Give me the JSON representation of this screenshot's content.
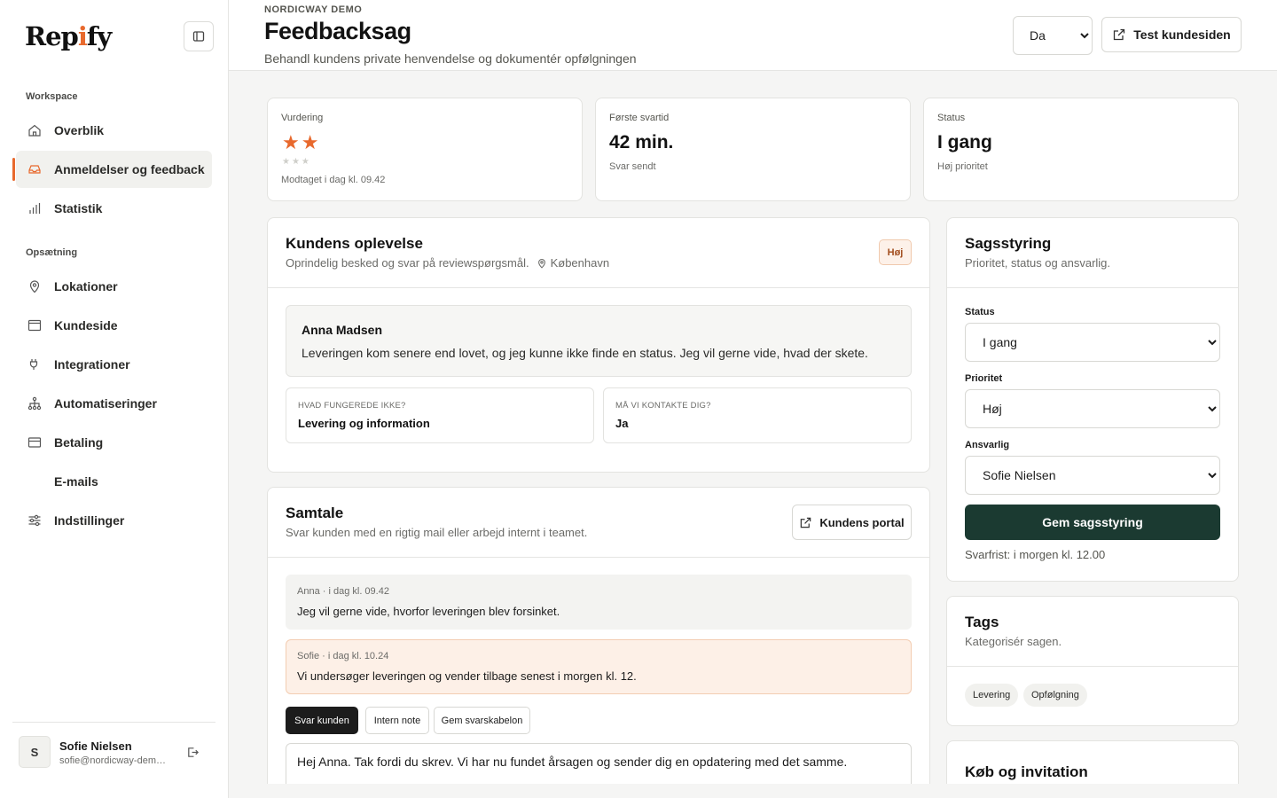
{
  "brand": {
    "name": "Repify",
    "accent": "#e8692d"
  },
  "sidebar": {
    "sections": {
      "workspace": "Workspace",
      "setup": "Opsætning"
    },
    "items": [
      {
        "label": "Overblik",
        "icon": "home-icon"
      },
      {
        "label": "Anmeldelser og feedback",
        "icon": "inbox-icon",
        "active": true
      },
      {
        "label": "Statistik",
        "icon": "bar-chart-icon"
      },
      {
        "label": "Lokationer",
        "icon": "map-pin-icon"
      },
      {
        "label": "Kundeside",
        "icon": "browser-icon"
      },
      {
        "label": "Integrationer",
        "icon": "plug-icon"
      },
      {
        "label": "Automatiseringer",
        "icon": "workflow-icon"
      },
      {
        "label": "Betaling",
        "icon": "credit-card-icon"
      },
      {
        "label": "E-mails",
        "icon": ""
      },
      {
        "label": "Indstillinger",
        "icon": "sliders-icon"
      }
    ],
    "user": {
      "initial": "S",
      "name": "Sofie Nielsen",
      "email": "sofie@nordicway-demo.dk"
    }
  },
  "header": {
    "eyebrow": "NORDICWAY DEMO",
    "title": "Feedbacksag",
    "subtitle": "Behandl kundens private henvendelse og dokumentér opfølgningen",
    "language": {
      "selected": "Da",
      "options": [
        "Da"
      ]
    },
    "test_button": "Test kundesiden"
  },
  "stats": {
    "rating": {
      "label": "Vurdering",
      "value": 2,
      "max": 5,
      "sub": "Modtaget i dag kl. 09.42"
    },
    "first_reply": {
      "label": "Første svartid",
      "value": "42 min.",
      "sub": "Svar sendt"
    },
    "status": {
      "label": "Status",
      "value": "I gang",
      "sub": "Høj prioritet"
    }
  },
  "experience": {
    "title": "Kundens oplevelse",
    "subtitle": "Oprindelig besked og svar på reviewspørgsmål.",
    "location": "København",
    "badge": "Høj",
    "customer_name": "Anna Madsen",
    "message": "Leveringen kom senere end lovet, og jeg kunne ikke finde en status. Jeg vil gerne vide, hvad der skete.",
    "answers": [
      {
        "label": "HVAD FUNGEREDE IKKE?",
        "value": "Levering og information"
      },
      {
        "label": "MÅ VI KONTAKTE DIG?",
        "value": "Ja"
      }
    ]
  },
  "conversation": {
    "title": "Samtale",
    "subtitle": "Svar kunden med en rigtig mail eller arbejd internt i teamet.",
    "portal_button": "Kundens portal",
    "messages": [
      {
        "meta": "Anna · i dag kl. 09.42",
        "text": "Jeg vil gerne vide, hvorfor leveringen blev forsinket.",
        "bg": "#f3f3f1",
        "border": "#f3f3f1"
      },
      {
        "meta": "Sofie · i dag kl. 10.24",
        "text": "Vi undersøger leveringen og vender tilbage senest i morgen kl. 12.",
        "bg": "#fdf0e7",
        "border": "#f3cdb2"
      }
    ],
    "tabs": [
      "Svar kunden",
      "Intern note",
      "Gem svarskabelon"
    ],
    "draft": "Hej Anna. Tak fordi du skrev. Vi har nu fundet årsagen og sender dig en opdatering med det samme."
  },
  "case_management": {
    "title": "Sagsstyring",
    "subtitle": "Prioritet, status og ansvarlig.",
    "status_label": "Status",
    "status_value": "I gang",
    "priority_label": "Prioritet",
    "priority_value": "Høj",
    "owner_label": "Ansvarlig",
    "owner_value": "Sofie Nielsen",
    "save_button": "Gem sagsstyring",
    "deadline": "Svarfrist: i morgen kl. 12.00",
    "save_color": "#1b3a31"
  },
  "tags": {
    "title": "Tags",
    "subtitle": "Kategorisér sagen.",
    "items": [
      "Levering",
      "Opfølgning"
    ]
  },
  "purchase": {
    "title": "Køb og invitation"
  }
}
